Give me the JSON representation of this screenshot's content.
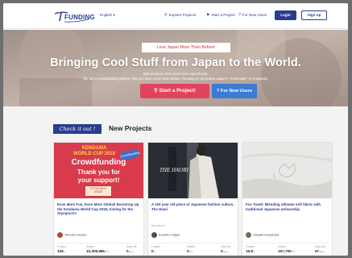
{
  "header": {
    "logo_text": "FUNDING",
    "language": "English ▾",
    "explore": "Explore Projects",
    "start": "Start a Project",
    "new_users": "For New Users",
    "login": "Login",
    "signup": "Sign up"
  },
  "hero": {
    "pill": "Love Japan More Than Before!",
    "title": "Bringing Cool Stuff from Japan to the World.",
    "line1": "New services, new never ever experiences.",
    "line2": "We are a crowdfunding platform that you have never seen before, focusing on promoting Japan's \"Handmade\" or Tonglasity.",
    "start_button": "Start a Project!",
    "new_users_button": "For New Users"
  },
  "section": {
    "badge": "Check it out !",
    "title": "New Projects"
  },
  "cards": [
    {
      "image": {
        "line1": "KENDAMA",
        "line2": "WORLD CUP 2018",
        "line3": "Crowdfunding",
        "line4": "Thank you for",
        "line5": "your support!",
        "sticker": "Crowdfunding",
        "box": "TO THE NEXT STAGE"
      },
      "title": "Even More Fun, Even More Global! Bootstrap Up the Kendama World Cup 2018, Aiming for the Olympics!!!",
      "owner": "Tomoko Kazato",
      "stats": [
        {
          "label": "Funded",
          "value": "106",
          "unit": "%"
        },
        {
          "label": "Raised",
          "value": "10,305,986",
          "unit": "JPY"
        },
        {
          "label": "Days left",
          "value": "0",
          "unit": "days"
        }
      ]
    },
    {
      "image": {
        "text": "THE HAORI"
      },
      "title": "A 100 year old piece of Japanese fashion culture, The Haori",
      "subtitle": "Introduce",
      "owner": "Kunihiro Tajiya",
      "stats": [
        {
          "label": "Funded",
          "value": "0",
          "unit": "%"
        },
        {
          "label": "Raised",
          "value": "0",
          "unit": "JPY"
        },
        {
          "label": "Days left",
          "value": "0",
          "unit": "days"
        }
      ]
    },
    {
      "image": {},
      "title": "Fox Towel: Blending ultimate soft fabric with traditional Japanese artisanship",
      "owner": "Hisaaki Kuwabara",
      "stats": [
        {
          "label": "Funded",
          "value": "15.8",
          "unit": "%"
        },
        {
          "label": "Raised",
          "value": "157,700",
          "unit": "JPY"
        },
        {
          "label": "Days left",
          "value": "57",
          "unit": "days"
        }
      ]
    }
  ],
  "colors": {
    "navy": "#2a3d8f",
    "accent_red": "#e0435b",
    "accent_blue": "#3a7bd5",
    "kendama_red": "#d83b4b"
  }
}
